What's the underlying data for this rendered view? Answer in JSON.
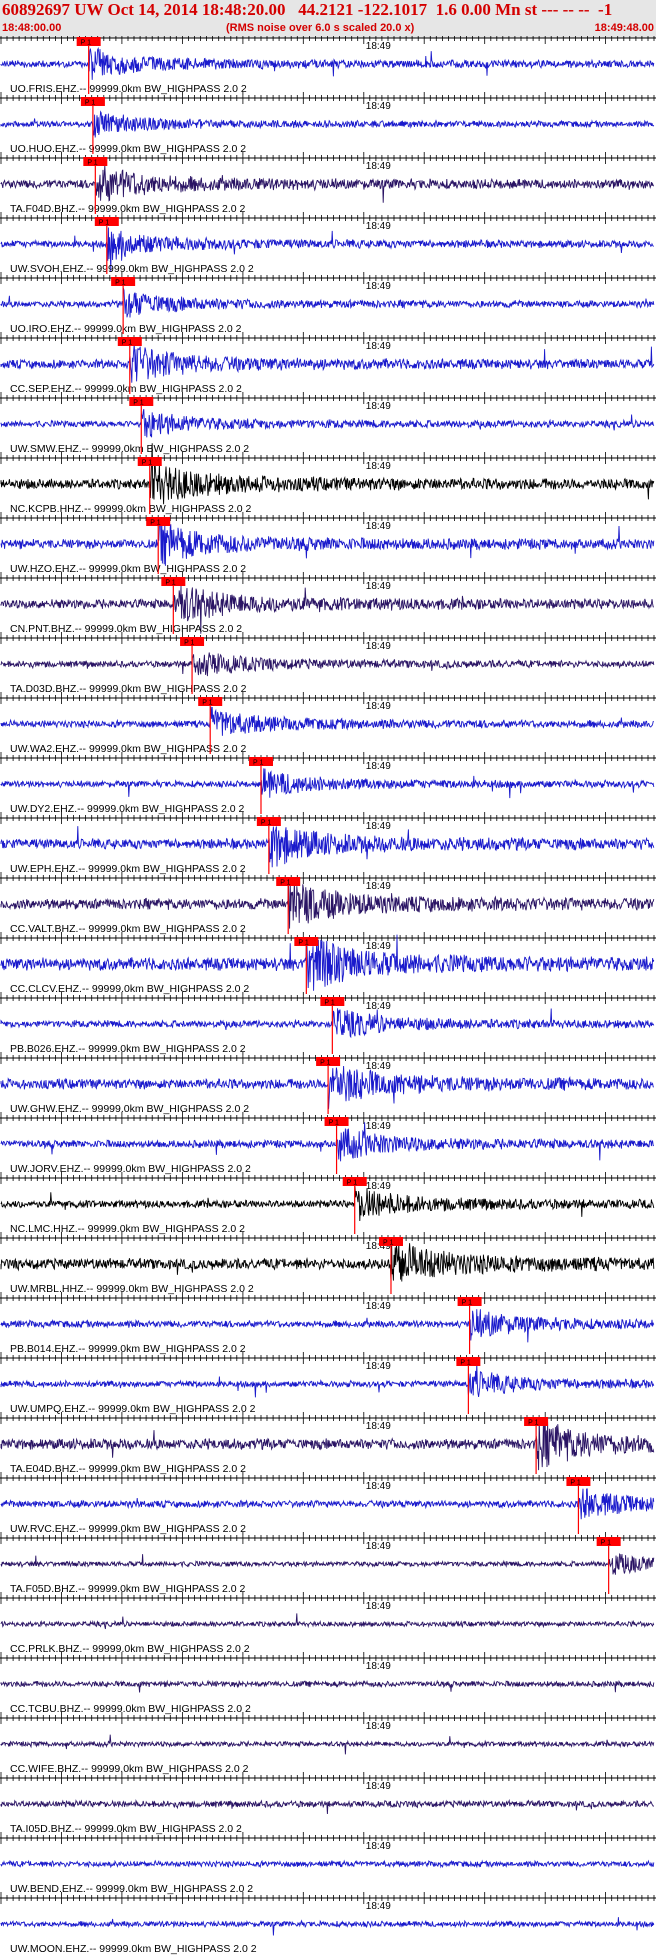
{
  "header": {
    "title": "60892697 UW Oct 14, 2014 18:48:20.00   44.2121 -122.1017  1.6 0.00 Mn st --- -- --  -1",
    "start_time": "18:48:00.00",
    "rms_note": "(RMS noise over 6.0 s scaled 20.0 x)",
    "end_time": "18:49:48.00",
    "minute_mark": "18:49"
  },
  "colors": {
    "header_text": "#d40000",
    "header_bg": "#e6e6e6",
    "pick": "#ff0000",
    "blue": "#1a1acc",
    "purple": "#2a1464",
    "black": "#000000"
  },
  "chart_data": {
    "type": "seismogram",
    "time_range_s": [
      0,
      108
    ],
    "minute_mark_s": 60,
    "pick_label": "P 1",
    "traces": [
      {
        "label": "UO.FRIS.EHZ.-- 99999.0km BW_HIGHPASS  2.0  2",
        "color": "blue",
        "pick_s": 14.5,
        "amp": 0.55
      },
      {
        "label": "UO.HUO.EHZ.-- 99999.0km BW_HIGHPASS  2.0  2",
        "color": "blue",
        "pick_s": 15.2,
        "amp": 0.45
      },
      {
        "label": "TA.F04D.BHZ.-- 99999.0km BW_HIGHPASS  2.0  2",
        "color": "purple",
        "pick_s": 15.6,
        "amp": 0.7
      },
      {
        "label": "UW.SVOH.EHZ.-- 99999.0km BW_HIGHPASS  2.0  2",
        "color": "blue",
        "pick_s": 17.5,
        "amp": 0.55
      },
      {
        "label": "UO.IRO.EHZ.-- 99999.0km BW_HIGHPASS  2.0  2",
        "color": "blue",
        "pick_s": 20.2,
        "amp": 0.5
      },
      {
        "label": "CC.SEP.EHZ.-- 99999.0km BW_HIGHPASS  2.0  2",
        "color": "blue",
        "pick_s": 21.3,
        "amp": 0.7
      },
      {
        "label": "UW.SMW.EHZ.-- 99999.0km BW_HIGHPASS  2.0  2",
        "color": "blue",
        "pick_s": 23.2,
        "amp": 0.5
      },
      {
        "label": "NC.KCPB.HHZ.-- 99999.0km BW_HIGHPASS  2.0  2",
        "color": "black",
        "pick_s": 24.6,
        "amp": 0.8
      },
      {
        "label": "UW.HZO.EHZ.-- 99999.0km BW_HIGHPASS  2.0  2",
        "color": "blue",
        "pick_s": 26.0,
        "amp": 0.75
      },
      {
        "label": "CN.PNT.BHZ.-- 99999.0km BW_HIGHPASS  2.0  2",
        "color": "purple",
        "pick_s": 28.5,
        "amp": 0.75
      },
      {
        "label": "TA.D03D.BHZ.-- 99999.0km BW_HIGHPASS  2.0  2",
        "color": "purple",
        "pick_s": 31.6,
        "amp": 0.5
      },
      {
        "label": "UW.WA2.EHZ.-- 99999.0km BW_HIGHPASS  2.0  2",
        "color": "blue",
        "pick_s": 34.6,
        "amp": 0.55
      },
      {
        "label": "UW.DY2.EHZ.-- 99999.0km BW_HIGHPASS  2.0  2",
        "color": "blue",
        "pick_s": 43.0,
        "amp": 0.5
      },
      {
        "label": "UW.EPH.EHZ.-- 99999.0km BW_HIGHPASS  2.0  2",
        "color": "blue",
        "pick_s": 44.3,
        "amp": 0.8
      },
      {
        "label": "CC.VALT.BHZ.-- 99999.0km BW_HIGHPASS  2.0  2",
        "color": "purple",
        "pick_s": 47.5,
        "amp": 0.85
      },
      {
        "label": "CC.CLCV.EHZ.-- 99999.0km BW_HIGHPASS  2.0  2",
        "color": "blue",
        "pick_s": 50.5,
        "amp": 1.0
      },
      {
        "label": "PB.B026.EHZ.-- 99999.0km BW_HIGHPASS  2.0  2",
        "color": "blue",
        "pick_s": 54.8,
        "amp": 0.55
      },
      {
        "label": "UW.GHW.EHZ.-- 99999.0km BW_HIGHPASS  2.0  2",
        "color": "blue",
        "pick_s": 54.1,
        "amp": 0.8
      },
      {
        "label": "UW.JORV.EHZ.-- 99999.0km BW_HIGHPASS  2.0  2",
        "color": "blue",
        "pick_s": 55.5,
        "amp": 0.6
      },
      {
        "label": "NC.LMC.HHZ.-- 99999.0km BW_HIGHPASS  2.0  2",
        "color": "black",
        "pick_s": 58.5,
        "amp": 0.6
      },
      {
        "label": "UW.MRBL.HHZ.-- 99999.0km BW_HIGHPASS  2.0  2",
        "color": "black",
        "pick_s": 64.5,
        "amp": 0.85
      },
      {
        "label": "PB.B014.EHZ.-- 99999.0km BW_HIGHPASS  2.0  2",
        "color": "blue",
        "pick_s": 77.5,
        "amp": 0.55
      },
      {
        "label": "UW.UMPQ.EHZ.-- 99999.0km BW_HIGHPASS  2.0  2",
        "color": "blue",
        "pick_s": 77.3,
        "amp": 0.5
      },
      {
        "label": "TA.E04D.BHZ.-- 99999.0km BW_HIGHPASS  2.0  2",
        "color": "purple",
        "pick_s": 88.5,
        "amp": 0.85
      },
      {
        "label": "UW.RVC.EHZ.-- 99999.0km BW_HIGHPASS  2.0  2",
        "color": "blue",
        "pick_s": 95.5,
        "amp": 0.55
      },
      {
        "label": "TA.F05D.BHZ.-- 99999.0km BW_HIGHPASS  2.0  2",
        "color": "purple",
        "pick_s": 100.5,
        "amp": 0.4
      },
      {
        "label": "CC.PRLK.BHZ.-- 99999.0km BW_HIGHPASS  2.0  2",
        "color": "purple",
        "pick_s": null,
        "amp": 0.4
      },
      {
        "label": "CC.TCBU.BHZ.-- 99999.0km BW_HIGHPASS  2.0  2",
        "color": "purple",
        "pick_s": null,
        "amp": 0.45
      },
      {
        "label": "CC.WIFE.BHZ.-- 99999.0km BW_HIGHPASS  2.0  2",
        "color": "purple",
        "pick_s": null,
        "amp": 0.4
      },
      {
        "label": "TA.I05D.BHZ.-- 99999.0km BW_HIGHPASS  2.0  2",
        "color": "purple",
        "pick_s": null,
        "amp": 0.5
      },
      {
        "label": "UW.BEND.EHZ.-- 99999.0km BW_HIGHPASS  2.0  2",
        "color": "blue",
        "pick_s": null,
        "amp": 0.45
      },
      {
        "label": "UW.MOON.EHZ.-- 99999.0km BW_HIGHPASS  2.0  2",
        "color": "blue",
        "pick_s": null,
        "amp": 0.45
      }
    ]
  }
}
